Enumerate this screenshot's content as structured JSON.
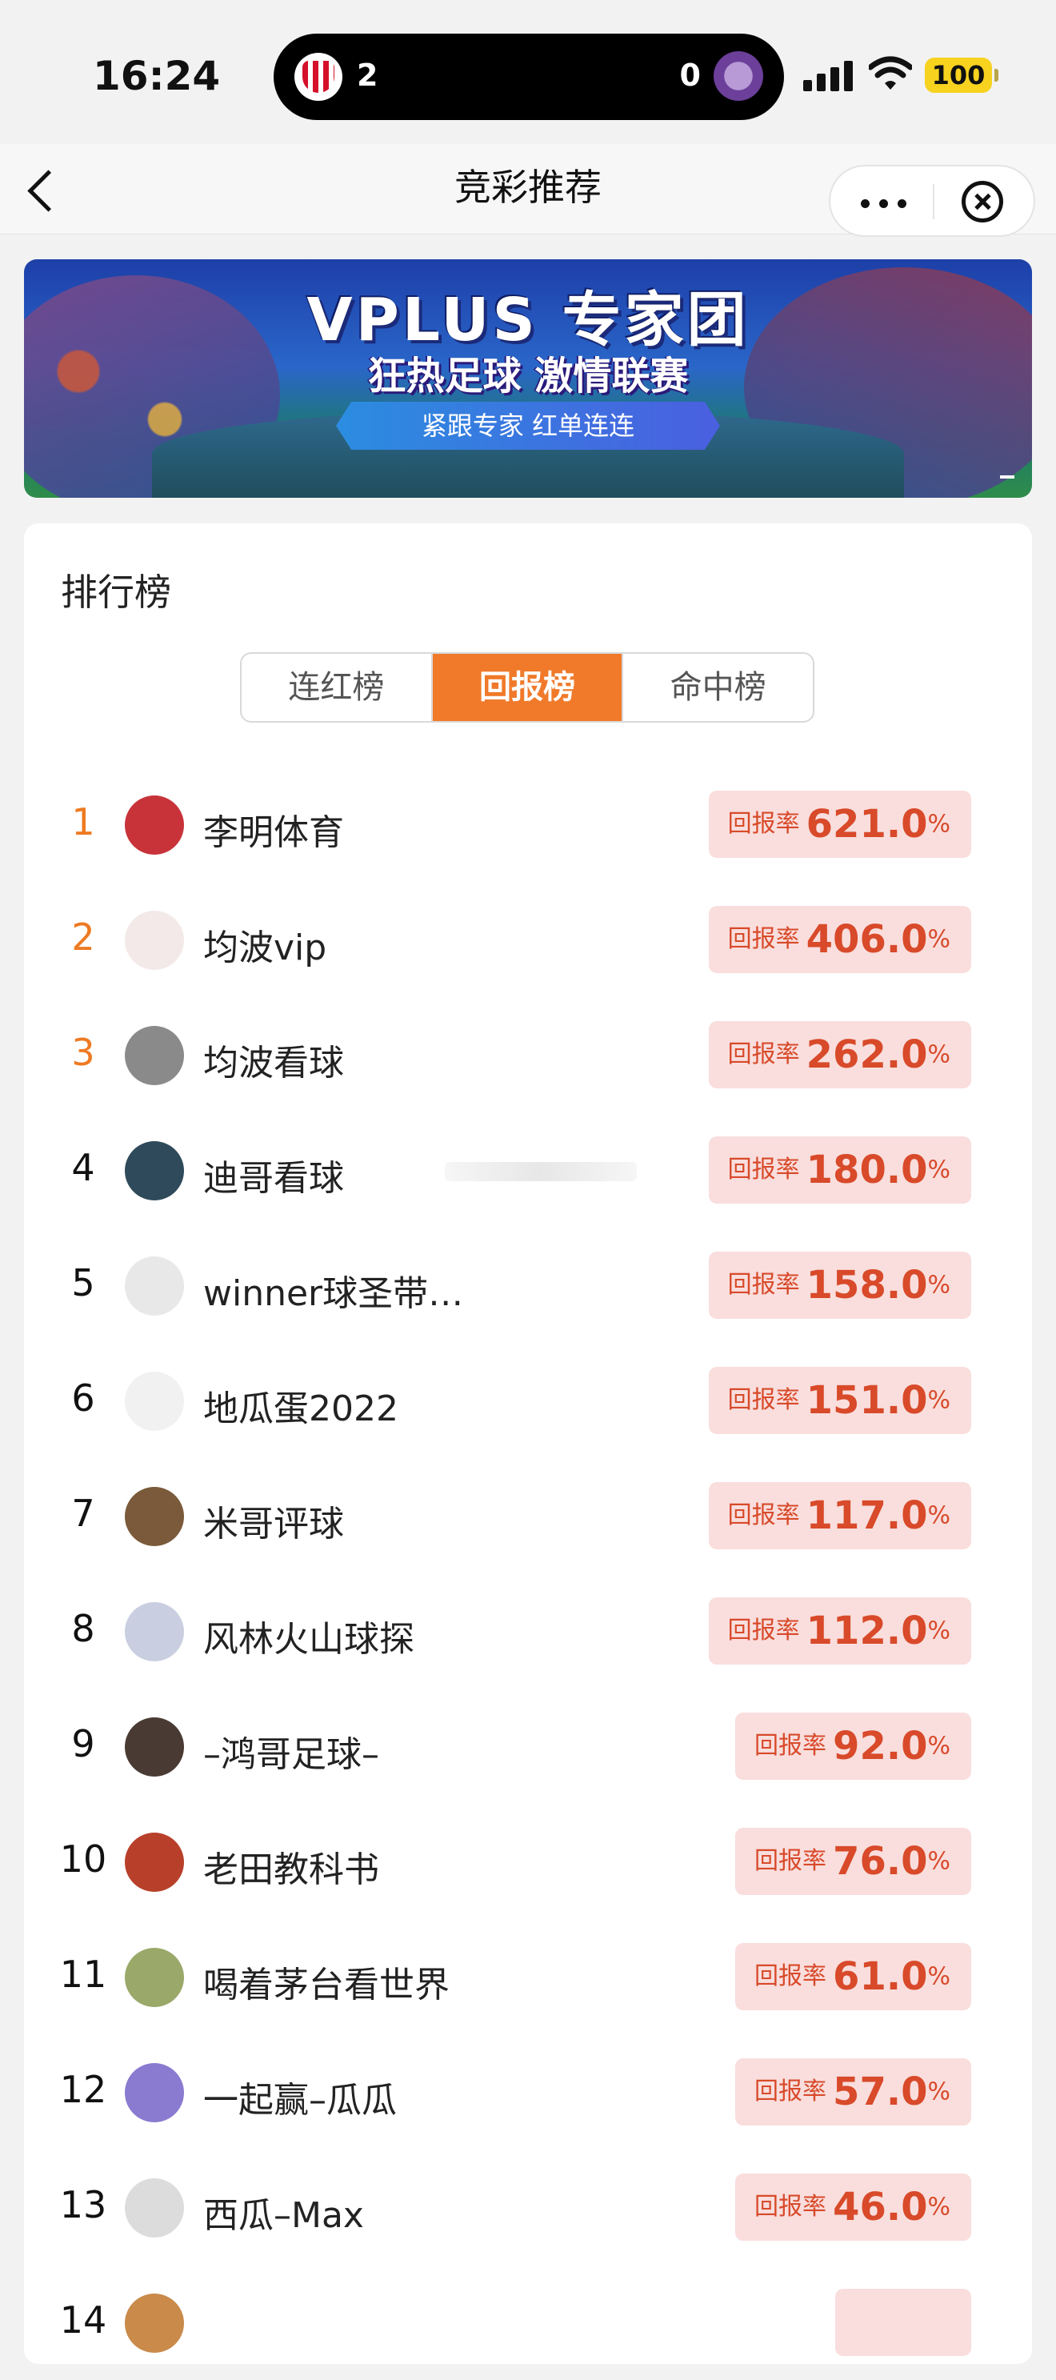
{
  "status_bar": {
    "time": "16:24",
    "score_home": "2",
    "score_away": "0",
    "battery": "100"
  },
  "nav": {
    "title": "竞彩推荐"
  },
  "banner": {
    "title": "VPLUS 专家团",
    "subtitle": "狂热足球 激情联赛",
    "ribbon": "紧跟专家 红单连连"
  },
  "leaderboard": {
    "title": "排行榜",
    "tabs": [
      "连红榜",
      "回报榜",
      "命中榜"
    ],
    "active_tab": 1,
    "rate_label": "回报率",
    "rate_unit": "%",
    "rows": [
      {
        "rank": "1",
        "name": "李明体育",
        "rate": "621.0",
        "avatar_color": "#c8333a"
      },
      {
        "rank": "2",
        "name": "均波vip",
        "rate": "406.0",
        "avatar_color": "#f3e9e9"
      },
      {
        "rank": "3",
        "name": "均波看球",
        "rate": "262.0",
        "avatar_color": "#8a8a8a"
      },
      {
        "rank": "4",
        "name": "迪哥看球",
        "rate": "180.0",
        "avatar_color": "#2f4a5a"
      },
      {
        "rank": "5",
        "name": "winner球圣带…",
        "rate": "158.0",
        "avatar_color": "#e8e8e8"
      },
      {
        "rank": "6",
        "name": "地瓜蛋2022",
        "rate": "151.0",
        "avatar_color": "#f1f1f1"
      },
      {
        "rank": "7",
        "name": "米哥评球",
        "rate": "117.0",
        "avatar_color": "#7a5a3a"
      },
      {
        "rank": "8",
        "name": "风林火山球探",
        "rate": "112.0",
        "avatar_color": "#c9cfe0"
      },
      {
        "rank": "9",
        "name": "–鸿哥足球–",
        "rate": "92.0",
        "avatar_color": "#4a3a34"
      },
      {
        "rank": "10",
        "name": "老田教科书",
        "rate": "76.0",
        "avatar_color": "#b8402a"
      },
      {
        "rank": "11",
        "name": "喝着茅台看世界",
        "rate": "61.0",
        "avatar_color": "#9aa86a"
      },
      {
        "rank": "12",
        "name": "一起赢–瓜瓜",
        "rate": "57.0",
        "avatar_color": "#8a7ad0"
      },
      {
        "rank": "13",
        "name": "西瓜–Max",
        "rate": "46.0",
        "avatar_color": "#dcdcdc"
      },
      {
        "rank": "14",
        "name": "",
        "rate": "",
        "avatar_color": "#c98a4a"
      }
    ]
  }
}
